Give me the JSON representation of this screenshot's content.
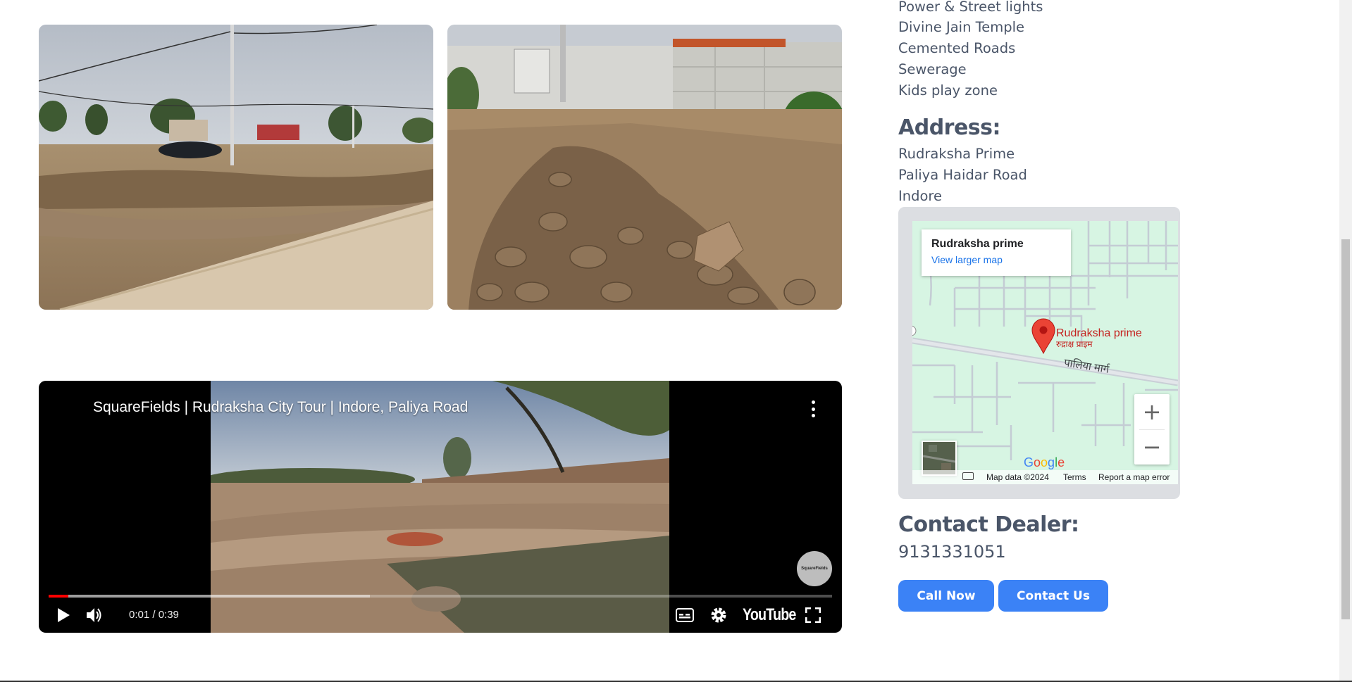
{
  "amenities": [
    "Power & Street lights",
    "Divine Jain Temple",
    "Cemented Roads",
    "Sewerage",
    "Kids play zone"
  ],
  "address": {
    "heading": "Address:",
    "lines": [
      "Rudraksha Prime",
      "Paliya Haidar Road",
      "Indore"
    ]
  },
  "map": {
    "place_name": "Rudraksha prime",
    "larger_map_link": "View larger map",
    "pin_label_en": "Rudraksha prime",
    "pin_label_hi": "रुद्राक्ष प्राइम",
    "road_label": "पालिया मार्ग",
    "zoom_in": "+",
    "zoom_out": "−",
    "google_logo": "Google",
    "map_data": "Map data ©2024",
    "terms": "Terms",
    "report": "Report a map error"
  },
  "contact": {
    "heading": "Contact Dealer:",
    "phone": "9131331051",
    "call_button": "Call Now",
    "contact_button": "Contact Us"
  },
  "video": {
    "title": "SquareFields | Rudraksha City Tour | Indore, Paliya Road",
    "time": "0:01 / 0:39",
    "channel_badge": "SquareFields",
    "youtube_logo": "YouTube",
    "played_fraction": 0.025,
    "buffered_fraction": 0.41
  },
  "colors": {
    "accent": "#3b82f6",
    "text": "#4a5568",
    "progress_played": "#ff0000",
    "map_link": "#1a73e8",
    "pin": "#ea4335"
  },
  "icons": [
    "play-icon",
    "volume-icon",
    "captions-icon",
    "settings-icon",
    "fullscreen-icon",
    "more-vert-icon",
    "keyboard-icon",
    "map-pin-icon"
  ]
}
